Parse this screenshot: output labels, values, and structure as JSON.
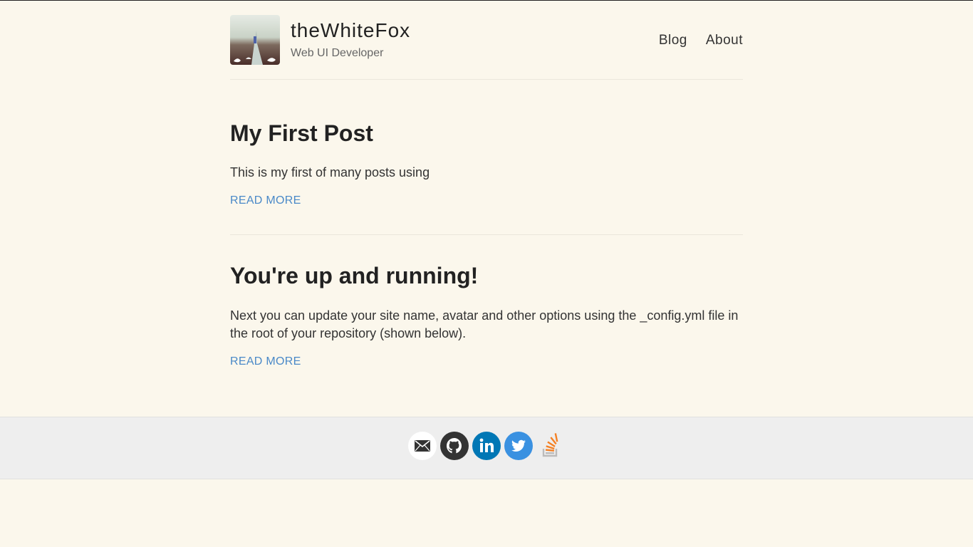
{
  "header": {
    "site_name": "theWhiteFox",
    "site_description": "Web UI Developer"
  },
  "nav": {
    "items": [
      {
        "label": "Blog"
      },
      {
        "label": "About"
      }
    ]
  },
  "posts": [
    {
      "title": "My First Post",
      "excerpt": "This is my first of many posts using",
      "read_more": "READ MORE"
    },
    {
      "title": "You're up and running!",
      "excerpt": "Next you can update your site name, avatar and other options using the _config.yml file in the root of your repository (shown below).",
      "read_more": "READ MORE"
    }
  ],
  "footer": {
    "social": [
      {
        "name": "email-icon",
        "color": "#ffffff"
      },
      {
        "name": "github-icon",
        "color": "#333333"
      },
      {
        "name": "linkedin-icon",
        "color": "#0077b5"
      },
      {
        "name": "twitter-icon",
        "color": "#3a91e1"
      },
      {
        "name": "stackoverflow-icon",
        "color": "#f48024"
      }
    ]
  },
  "colors": {
    "background": "#fbf7ec",
    "link": "#4a89c8",
    "footer_bg": "#eeeeee"
  }
}
